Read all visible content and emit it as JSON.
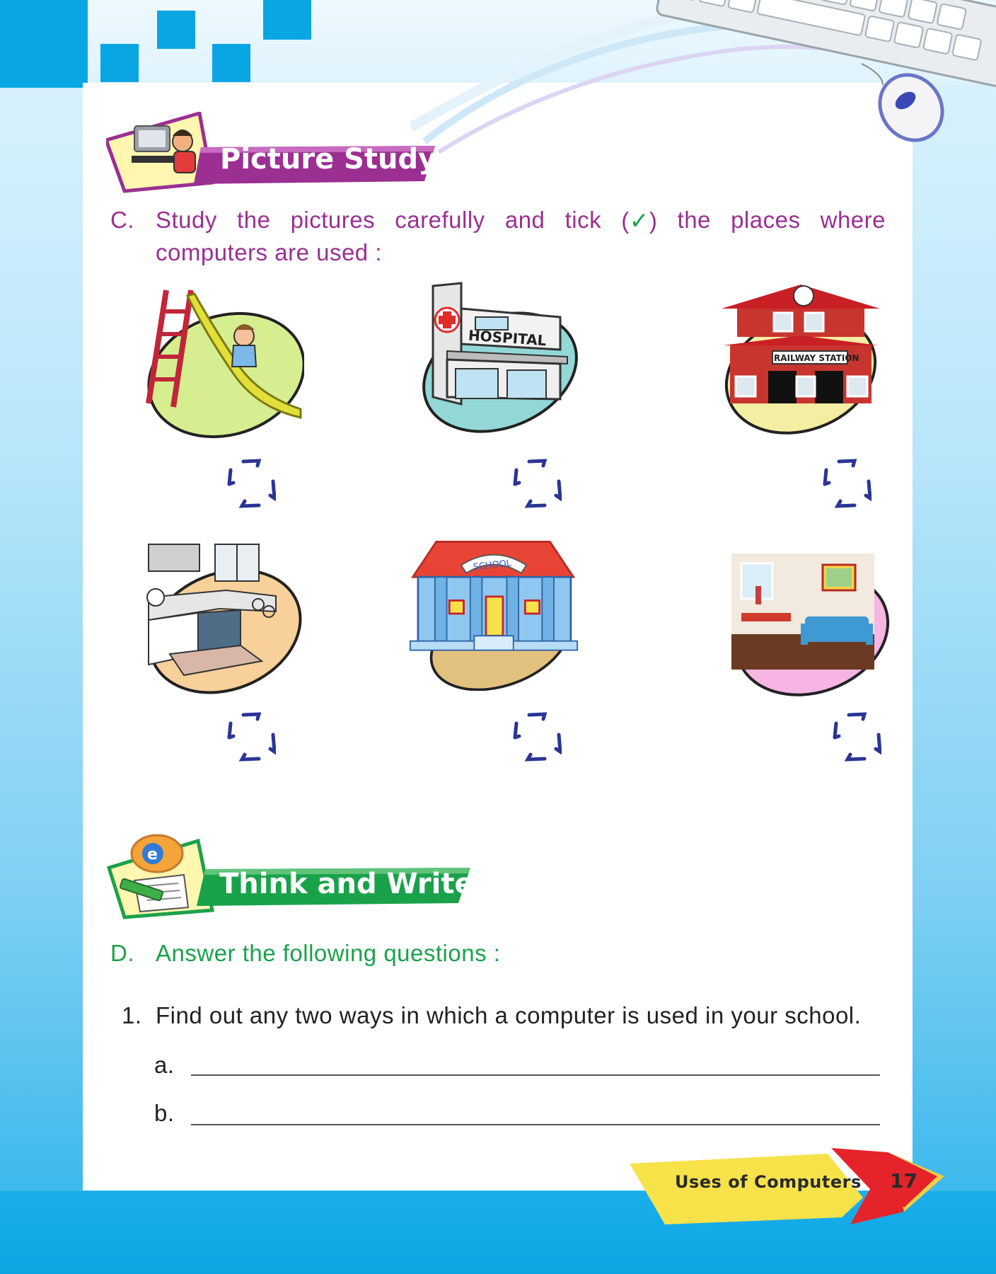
{
  "section1": {
    "title": "Picture Study",
    "question_letter": "C.",
    "question_line1": "Study the pictures carefully and tick (",
    "tick_symbol": "✓",
    "question_line1_end": ") the places where",
    "question_line2": "computers are used :"
  },
  "pictures": [
    {
      "label": "",
      "icon": "playground-slide-icon",
      "bg": "#cfe98a"
    },
    {
      "label": "HOSPITAL",
      "icon": "hospital-icon",
      "bg": "#8ed6d6"
    },
    {
      "label": "RAILWAY STATION",
      "icon": "railway-station-icon",
      "bg": "#f3f0a8"
    },
    {
      "label": "",
      "icon": "kitchen-icon",
      "bg": "#f7cf99"
    },
    {
      "label": "SCHOOL",
      "icon": "school-icon",
      "bg": "#e4c27f"
    },
    {
      "label": "",
      "icon": "living-room-icon",
      "bg": "#f3b3e0"
    }
  ],
  "section2": {
    "title": "Think and Write",
    "question_letter": "D.",
    "question_text": "Answer the following questions :",
    "q1_number": "1.",
    "q1_text": "Find out any two ways in which a computer is used in your school.",
    "answer_a": "a.",
    "answer_b": "b."
  },
  "footer": {
    "chapter": "Uses of Computers",
    "page_number": "17"
  },
  "colors": {
    "purple": "#9b2f92",
    "green": "#1aa24a",
    "blue": "#0aa6e3",
    "tick_box": "#2a3595",
    "footer_yellow": "#f7e24a",
    "footer_red": "#e5232a"
  }
}
